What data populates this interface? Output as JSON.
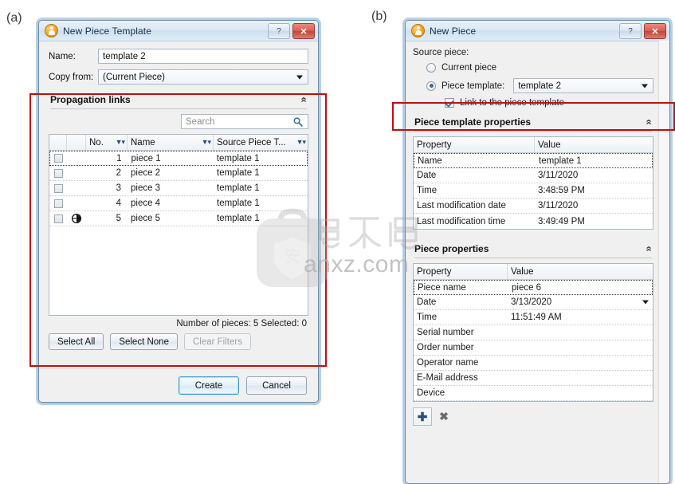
{
  "figure": {
    "label_a": "(a)",
    "label_b": "(b)"
  },
  "dialog_a": {
    "title": "New Piece Template",
    "help_label": "?",
    "close_label": "✕",
    "fields": {
      "name_label": "Name:",
      "name_value": "template 2",
      "copyfrom_label": "Copy from:",
      "copyfrom_value": "(Current Piece)"
    },
    "section": {
      "title": "Propagation links",
      "collapse_icon": "«"
    },
    "search": {
      "placeholder": "Search",
      "icon": "search-icon"
    },
    "grid": {
      "columns": [
        "",
        "",
        "No.",
        "Name",
        "Source Piece T..."
      ],
      "rows": [
        {
          "checked": false,
          "flag": "",
          "no": "1",
          "name": "piece 1",
          "source": "template 1"
        },
        {
          "checked": false,
          "flag": "",
          "no": "2",
          "name": "piece 2",
          "source": "template 1"
        },
        {
          "checked": false,
          "flag": "",
          "no": "3",
          "name": "piece 3",
          "source": "template 1"
        },
        {
          "checked": false,
          "flag": "",
          "no": "4",
          "name": "piece 4",
          "source": "template 1"
        },
        {
          "checked": false,
          "flag": "◔",
          "no": "5",
          "name": "piece 5",
          "source": "template 1"
        }
      ]
    },
    "status": "Number of pieces: 5 Selected: 0",
    "buttons": {
      "select_all": "Select All",
      "select_none": "Select None",
      "clear_filters": "Clear Filters",
      "create": "Create",
      "cancel": "Cancel"
    }
  },
  "dialog_b": {
    "title": "New Piece",
    "help_label": "?",
    "close_label": "✕",
    "source_piece_label": "Source piece:",
    "radio_current_piece": "Current piece",
    "radio_piece_template": "Piece template:",
    "piece_template_value": "template 2",
    "link_checkbox_label": "Link to the piece template",
    "template_props": {
      "title": "Piece template properties",
      "collapse_icon": "«",
      "columns": [
        "Property",
        "Value"
      ],
      "rows": [
        {
          "property": "Name",
          "value": "template 1"
        },
        {
          "property": "Date",
          "value": "3/11/2020"
        },
        {
          "property": "Time",
          "value": "3:48:59 PM"
        },
        {
          "property": "Last modification date",
          "value": "3/11/2020"
        },
        {
          "property": "Last modification time",
          "value": "3:49:49 PM"
        }
      ]
    },
    "piece_props": {
      "title": "Piece properties",
      "collapse_icon": "«",
      "columns": [
        "Property",
        "Value"
      ],
      "rows": [
        {
          "property": "Piece name",
          "value": "piece 6",
          "dropdown": false
        },
        {
          "property": "Date",
          "value": "3/13/2020",
          "dropdown": true
        },
        {
          "property": "Time",
          "value": "11:51:49 AM",
          "dropdown": false
        },
        {
          "property": "Serial number",
          "value": "",
          "dropdown": false
        },
        {
          "property": "Order number",
          "value": "",
          "dropdown": false
        },
        {
          "property": "Operator name",
          "value": "",
          "dropdown": false
        },
        {
          "property": "E-Mail address",
          "value": "",
          "dropdown": false
        },
        {
          "property": "Device",
          "value": "",
          "dropdown": false
        }
      ]
    },
    "toolbar": {
      "add": "✚",
      "remove": "✖"
    }
  },
  "watermark": {
    "text": "anxz.com",
    "cn": "安下载"
  },
  "colors": {
    "annotation_red": "#c10e0e",
    "title_blue": "#12304d",
    "accent": "#3c9bd4"
  }
}
